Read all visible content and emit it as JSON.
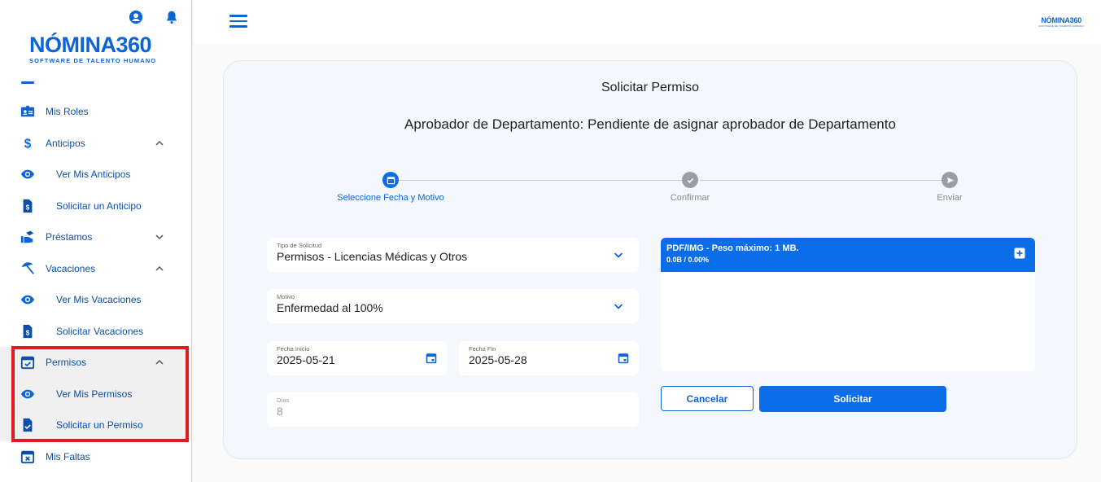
{
  "brand": {
    "logo_main": "NÓMINA360",
    "logo_sub": "SOFTWARE DE TALENTO HUMANO",
    "mini_logo": "NÓMINA360",
    "mini_logo_sub": "SOFTWARE DE TALENTO HUMANO",
    "accent_color": "#0b64d8"
  },
  "sidebar": {
    "items": [
      {
        "label": "Mis Roles",
        "icon": "id-card-icon"
      },
      {
        "label": "Anticipos",
        "icon": "dollar-icon",
        "expanded": true
      },
      {
        "label": "Ver Mis Anticipos",
        "icon": "eye-icon"
      },
      {
        "label": "Solicitar un Anticipo",
        "icon": "document-dollar-icon"
      },
      {
        "label": "Préstamos",
        "icon": "hand-money-icon",
        "expanded": false
      },
      {
        "label": "Vacaciones",
        "icon": "beach-umbrella-icon",
        "expanded": true
      },
      {
        "label": "Ver Mis Vacaciones",
        "icon": "eye-icon"
      },
      {
        "label": "Solicitar Vacaciones",
        "icon": "document-dollar-icon"
      },
      {
        "label": "Permisos",
        "icon": "calendar-check-icon",
        "expanded": true
      },
      {
        "label": "Ver Mis Permisos",
        "icon": "eye-icon"
      },
      {
        "label": "Solicitar un Permiso",
        "icon": "document-check-icon"
      },
      {
        "label": "Mis Faltas",
        "icon": "calendar-x-icon"
      }
    ]
  },
  "main": {
    "title": "Solicitar Permiso",
    "subtitle": "Aprobador de Departamento: Pendiente de asignar aprobador de Departamento",
    "steps": [
      {
        "label": "Seleccione Fecha y Motivo",
        "state": "active"
      },
      {
        "label": "Confirmar",
        "state": "pending"
      },
      {
        "label": "Enviar",
        "state": "pending"
      }
    ],
    "form": {
      "tipo_label": "Tipo de Solicitud",
      "tipo_value": "Permisos - Licencias Médicas y Otros",
      "motivo_label": "Motivo",
      "motivo_value": "Enfermedad al 100%",
      "fecha_inicio_label": "Fecha Inicio",
      "fecha_inicio_value": "2025-05-21",
      "fecha_fin_label": "Fecha Fin",
      "fecha_fin_value": "2025-05-28",
      "dias_label": "Días",
      "dias_value": "8"
    },
    "upload": {
      "title": "PDF/IMG - Peso máximo: 1 MB.",
      "progress": "0.0B / 0.00%"
    },
    "buttons": {
      "cancel": "Cancelar",
      "submit": "Solicitar"
    }
  }
}
